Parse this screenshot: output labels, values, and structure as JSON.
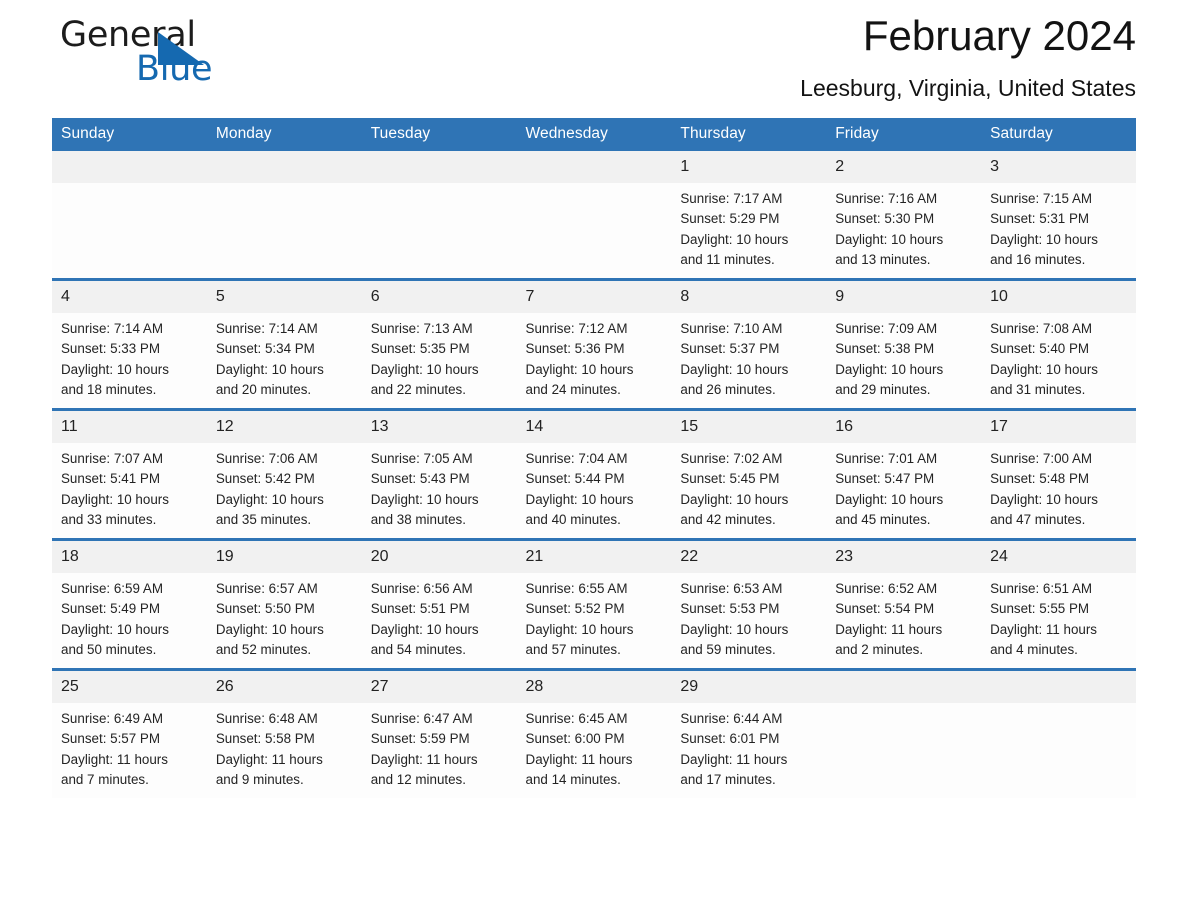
{
  "brand": {
    "word1": "General",
    "word2": "Blue",
    "flag_icon": "triangle-flag-icon",
    "accent_color": "#1569b0"
  },
  "header": {
    "title": "February 2024",
    "subtitle": "Leesburg, Virginia, United States"
  },
  "theme": {
    "header_blue": "#2f74b5",
    "daynum_band": "#f1f1f1",
    "cell_background": "#fdfdfd"
  },
  "calendar": {
    "weekday_headers": [
      "Sunday",
      "Monday",
      "Tuesday",
      "Wednesday",
      "Thursday",
      "Friday",
      "Saturday"
    ],
    "weeks": [
      [
        {
          "day": "",
          "sunrise": "",
          "sunset": "",
          "daylight": "",
          "daylight2": ""
        },
        {
          "day": "",
          "sunrise": "",
          "sunset": "",
          "daylight": "",
          "daylight2": ""
        },
        {
          "day": "",
          "sunrise": "",
          "sunset": "",
          "daylight": "",
          "daylight2": ""
        },
        {
          "day": "",
          "sunrise": "",
          "sunset": "",
          "daylight": "",
          "daylight2": ""
        },
        {
          "day": "1",
          "sunrise": "Sunrise: 7:17 AM",
          "sunset": "Sunset: 5:29 PM",
          "daylight": "Daylight: 10 hours",
          "daylight2": "and 11 minutes."
        },
        {
          "day": "2",
          "sunrise": "Sunrise: 7:16 AM",
          "sunset": "Sunset: 5:30 PM",
          "daylight": "Daylight: 10 hours",
          "daylight2": "and 13 minutes."
        },
        {
          "day": "3",
          "sunrise": "Sunrise: 7:15 AM",
          "sunset": "Sunset: 5:31 PM",
          "daylight": "Daylight: 10 hours",
          "daylight2": "and 16 minutes."
        }
      ],
      [
        {
          "day": "4",
          "sunrise": "Sunrise: 7:14 AM",
          "sunset": "Sunset: 5:33 PM",
          "daylight": "Daylight: 10 hours",
          "daylight2": "and 18 minutes."
        },
        {
          "day": "5",
          "sunrise": "Sunrise: 7:14 AM",
          "sunset": "Sunset: 5:34 PM",
          "daylight": "Daylight: 10 hours",
          "daylight2": "and 20 minutes."
        },
        {
          "day": "6",
          "sunrise": "Sunrise: 7:13 AM",
          "sunset": "Sunset: 5:35 PM",
          "daylight": "Daylight: 10 hours",
          "daylight2": "and 22 minutes."
        },
        {
          "day": "7",
          "sunrise": "Sunrise: 7:12 AM",
          "sunset": "Sunset: 5:36 PM",
          "daylight": "Daylight: 10 hours",
          "daylight2": "and 24 minutes."
        },
        {
          "day": "8",
          "sunrise": "Sunrise: 7:10 AM",
          "sunset": "Sunset: 5:37 PM",
          "daylight": "Daylight: 10 hours",
          "daylight2": "and 26 minutes."
        },
        {
          "day": "9",
          "sunrise": "Sunrise: 7:09 AM",
          "sunset": "Sunset: 5:38 PM",
          "daylight": "Daylight: 10 hours",
          "daylight2": "and 29 minutes."
        },
        {
          "day": "10",
          "sunrise": "Sunrise: 7:08 AM",
          "sunset": "Sunset: 5:40 PM",
          "daylight": "Daylight: 10 hours",
          "daylight2": "and 31 minutes."
        }
      ],
      [
        {
          "day": "11",
          "sunrise": "Sunrise: 7:07 AM",
          "sunset": "Sunset: 5:41 PM",
          "daylight": "Daylight: 10 hours",
          "daylight2": "and 33 minutes."
        },
        {
          "day": "12",
          "sunrise": "Sunrise: 7:06 AM",
          "sunset": "Sunset: 5:42 PM",
          "daylight": "Daylight: 10 hours",
          "daylight2": "and 35 minutes."
        },
        {
          "day": "13",
          "sunrise": "Sunrise: 7:05 AM",
          "sunset": "Sunset: 5:43 PM",
          "daylight": "Daylight: 10 hours",
          "daylight2": "and 38 minutes."
        },
        {
          "day": "14",
          "sunrise": "Sunrise: 7:04 AM",
          "sunset": "Sunset: 5:44 PM",
          "daylight": "Daylight: 10 hours",
          "daylight2": "and 40 minutes."
        },
        {
          "day": "15",
          "sunrise": "Sunrise: 7:02 AM",
          "sunset": "Sunset: 5:45 PM",
          "daylight": "Daylight: 10 hours",
          "daylight2": "and 42 minutes."
        },
        {
          "day": "16",
          "sunrise": "Sunrise: 7:01 AM",
          "sunset": "Sunset: 5:47 PM",
          "daylight": "Daylight: 10 hours",
          "daylight2": "and 45 minutes."
        },
        {
          "day": "17",
          "sunrise": "Sunrise: 7:00 AM",
          "sunset": "Sunset: 5:48 PM",
          "daylight": "Daylight: 10 hours",
          "daylight2": "and 47 minutes."
        }
      ],
      [
        {
          "day": "18",
          "sunrise": "Sunrise: 6:59 AM",
          "sunset": "Sunset: 5:49 PM",
          "daylight": "Daylight: 10 hours",
          "daylight2": "and 50 minutes."
        },
        {
          "day": "19",
          "sunrise": "Sunrise: 6:57 AM",
          "sunset": "Sunset: 5:50 PM",
          "daylight": "Daylight: 10 hours",
          "daylight2": "and 52 minutes."
        },
        {
          "day": "20",
          "sunrise": "Sunrise: 6:56 AM",
          "sunset": "Sunset: 5:51 PM",
          "daylight": "Daylight: 10 hours",
          "daylight2": "and 54 minutes."
        },
        {
          "day": "21",
          "sunrise": "Sunrise: 6:55 AM",
          "sunset": "Sunset: 5:52 PM",
          "daylight": "Daylight: 10 hours",
          "daylight2": "and 57 minutes."
        },
        {
          "day": "22",
          "sunrise": "Sunrise: 6:53 AM",
          "sunset": "Sunset: 5:53 PM",
          "daylight": "Daylight: 10 hours",
          "daylight2": "and 59 minutes."
        },
        {
          "day": "23",
          "sunrise": "Sunrise: 6:52 AM",
          "sunset": "Sunset: 5:54 PM",
          "daylight": "Daylight: 11 hours",
          "daylight2": "and 2 minutes."
        },
        {
          "day": "24",
          "sunrise": "Sunrise: 6:51 AM",
          "sunset": "Sunset: 5:55 PM",
          "daylight": "Daylight: 11 hours",
          "daylight2": "and 4 minutes."
        }
      ],
      [
        {
          "day": "25",
          "sunrise": "Sunrise: 6:49 AM",
          "sunset": "Sunset: 5:57 PM",
          "daylight": "Daylight: 11 hours",
          "daylight2": "and 7 minutes."
        },
        {
          "day": "26",
          "sunrise": "Sunrise: 6:48 AM",
          "sunset": "Sunset: 5:58 PM",
          "daylight": "Daylight: 11 hours",
          "daylight2": "and 9 minutes."
        },
        {
          "day": "27",
          "sunrise": "Sunrise: 6:47 AM",
          "sunset": "Sunset: 5:59 PM",
          "daylight": "Daylight: 11 hours",
          "daylight2": "and 12 minutes."
        },
        {
          "day": "28",
          "sunrise": "Sunrise: 6:45 AM",
          "sunset": "Sunset: 6:00 PM",
          "daylight": "Daylight: 11 hours",
          "daylight2": "and 14 minutes."
        },
        {
          "day": "29",
          "sunrise": "Sunrise: 6:44 AM",
          "sunset": "Sunset: 6:01 PM",
          "daylight": "Daylight: 11 hours",
          "daylight2": "and 17 minutes."
        },
        {
          "day": "",
          "sunrise": "",
          "sunset": "",
          "daylight": "",
          "daylight2": ""
        },
        {
          "day": "",
          "sunrise": "",
          "sunset": "",
          "daylight": "",
          "daylight2": ""
        }
      ]
    ]
  }
}
